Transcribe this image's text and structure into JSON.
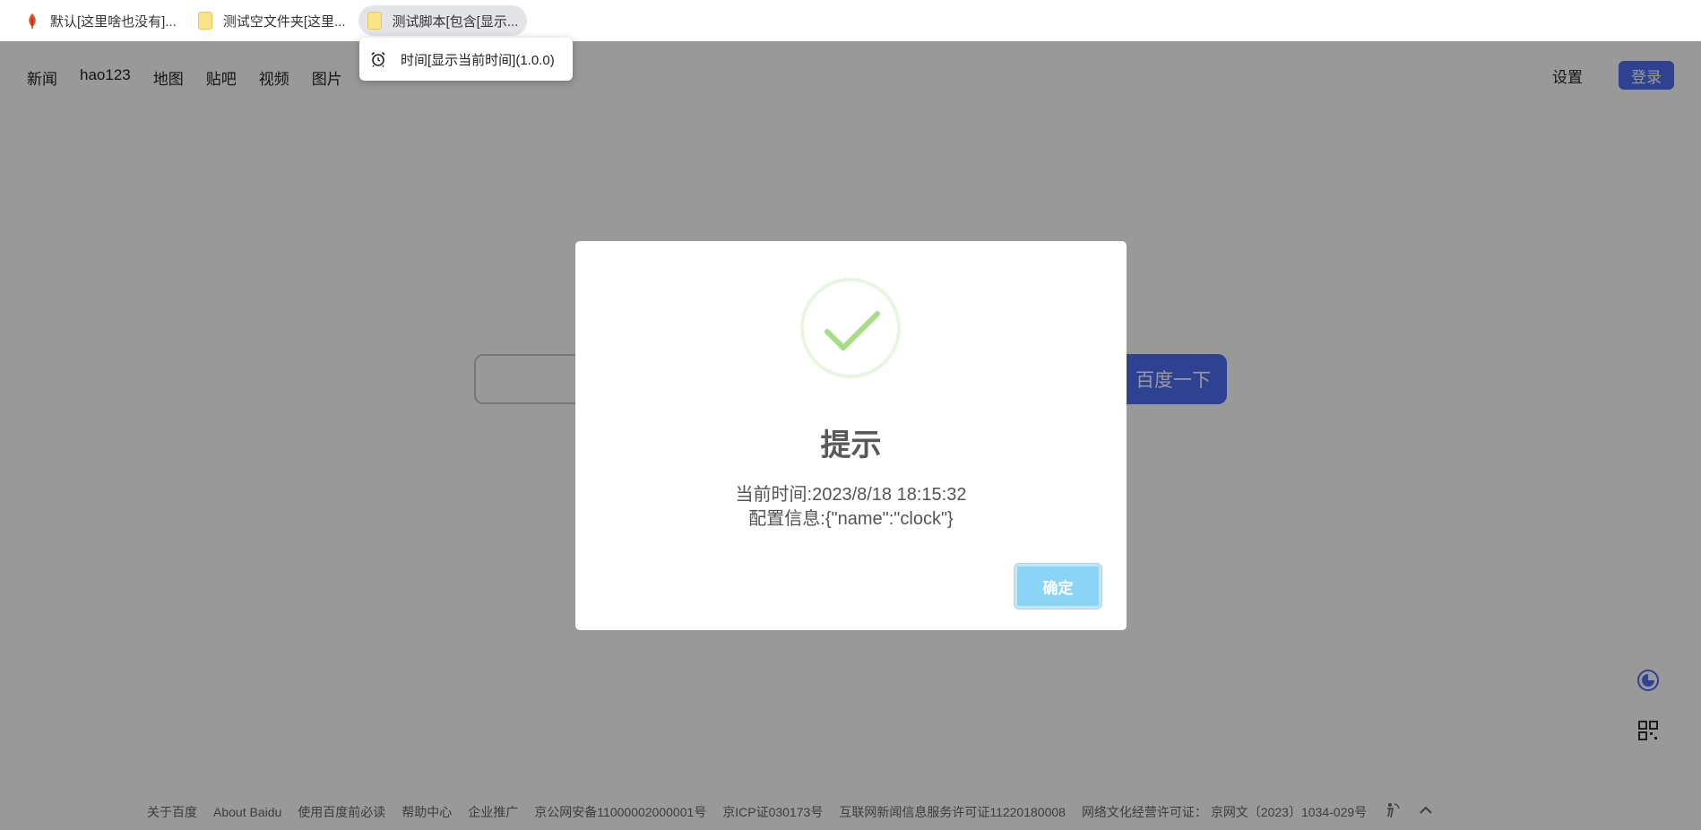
{
  "bookmarks": [
    {
      "label": "默认[这里啥也没有]...",
      "icon": "leaf-icon"
    },
    {
      "label": "测试空文件夹[这里...",
      "icon": "folder-icon"
    },
    {
      "label": "测试脚本[包含[显示...",
      "icon": "folder-icon",
      "active": true
    }
  ],
  "bookmark_dropdown": {
    "item_label": "时间[显示当前时间](1.0.0)",
    "icon": "alarm-clock-icon"
  },
  "nav": {
    "items": [
      "新闻",
      "hao123",
      "地图",
      "贴吧",
      "视频",
      "图片"
    ],
    "settings": "设置",
    "login": "登录"
  },
  "search": {
    "button_label": "百度一下"
  },
  "footer": {
    "links": [
      "关于百度",
      "About Baidu",
      "使用百度前必读",
      "帮助中心",
      "企业推广",
      "京公网安备11000002000001号",
      "京ICP证030173号",
      "互联网新闻信息服务许可证11220180008",
      "网络文化经营许可证： 京网文〔2023〕1034-029号"
    ]
  },
  "dialog": {
    "icon": "success-check-icon",
    "title": "提示",
    "line1": "当前时间:2023/8/18 18:15:32",
    "line2": "配置信息:{\"name\":\"clock\"}",
    "confirm_label": "确定"
  },
  "colors": {
    "accent": "#4e6ef2",
    "confirm_button": "#8cd4f5",
    "success_check": "#a5dc86"
  }
}
